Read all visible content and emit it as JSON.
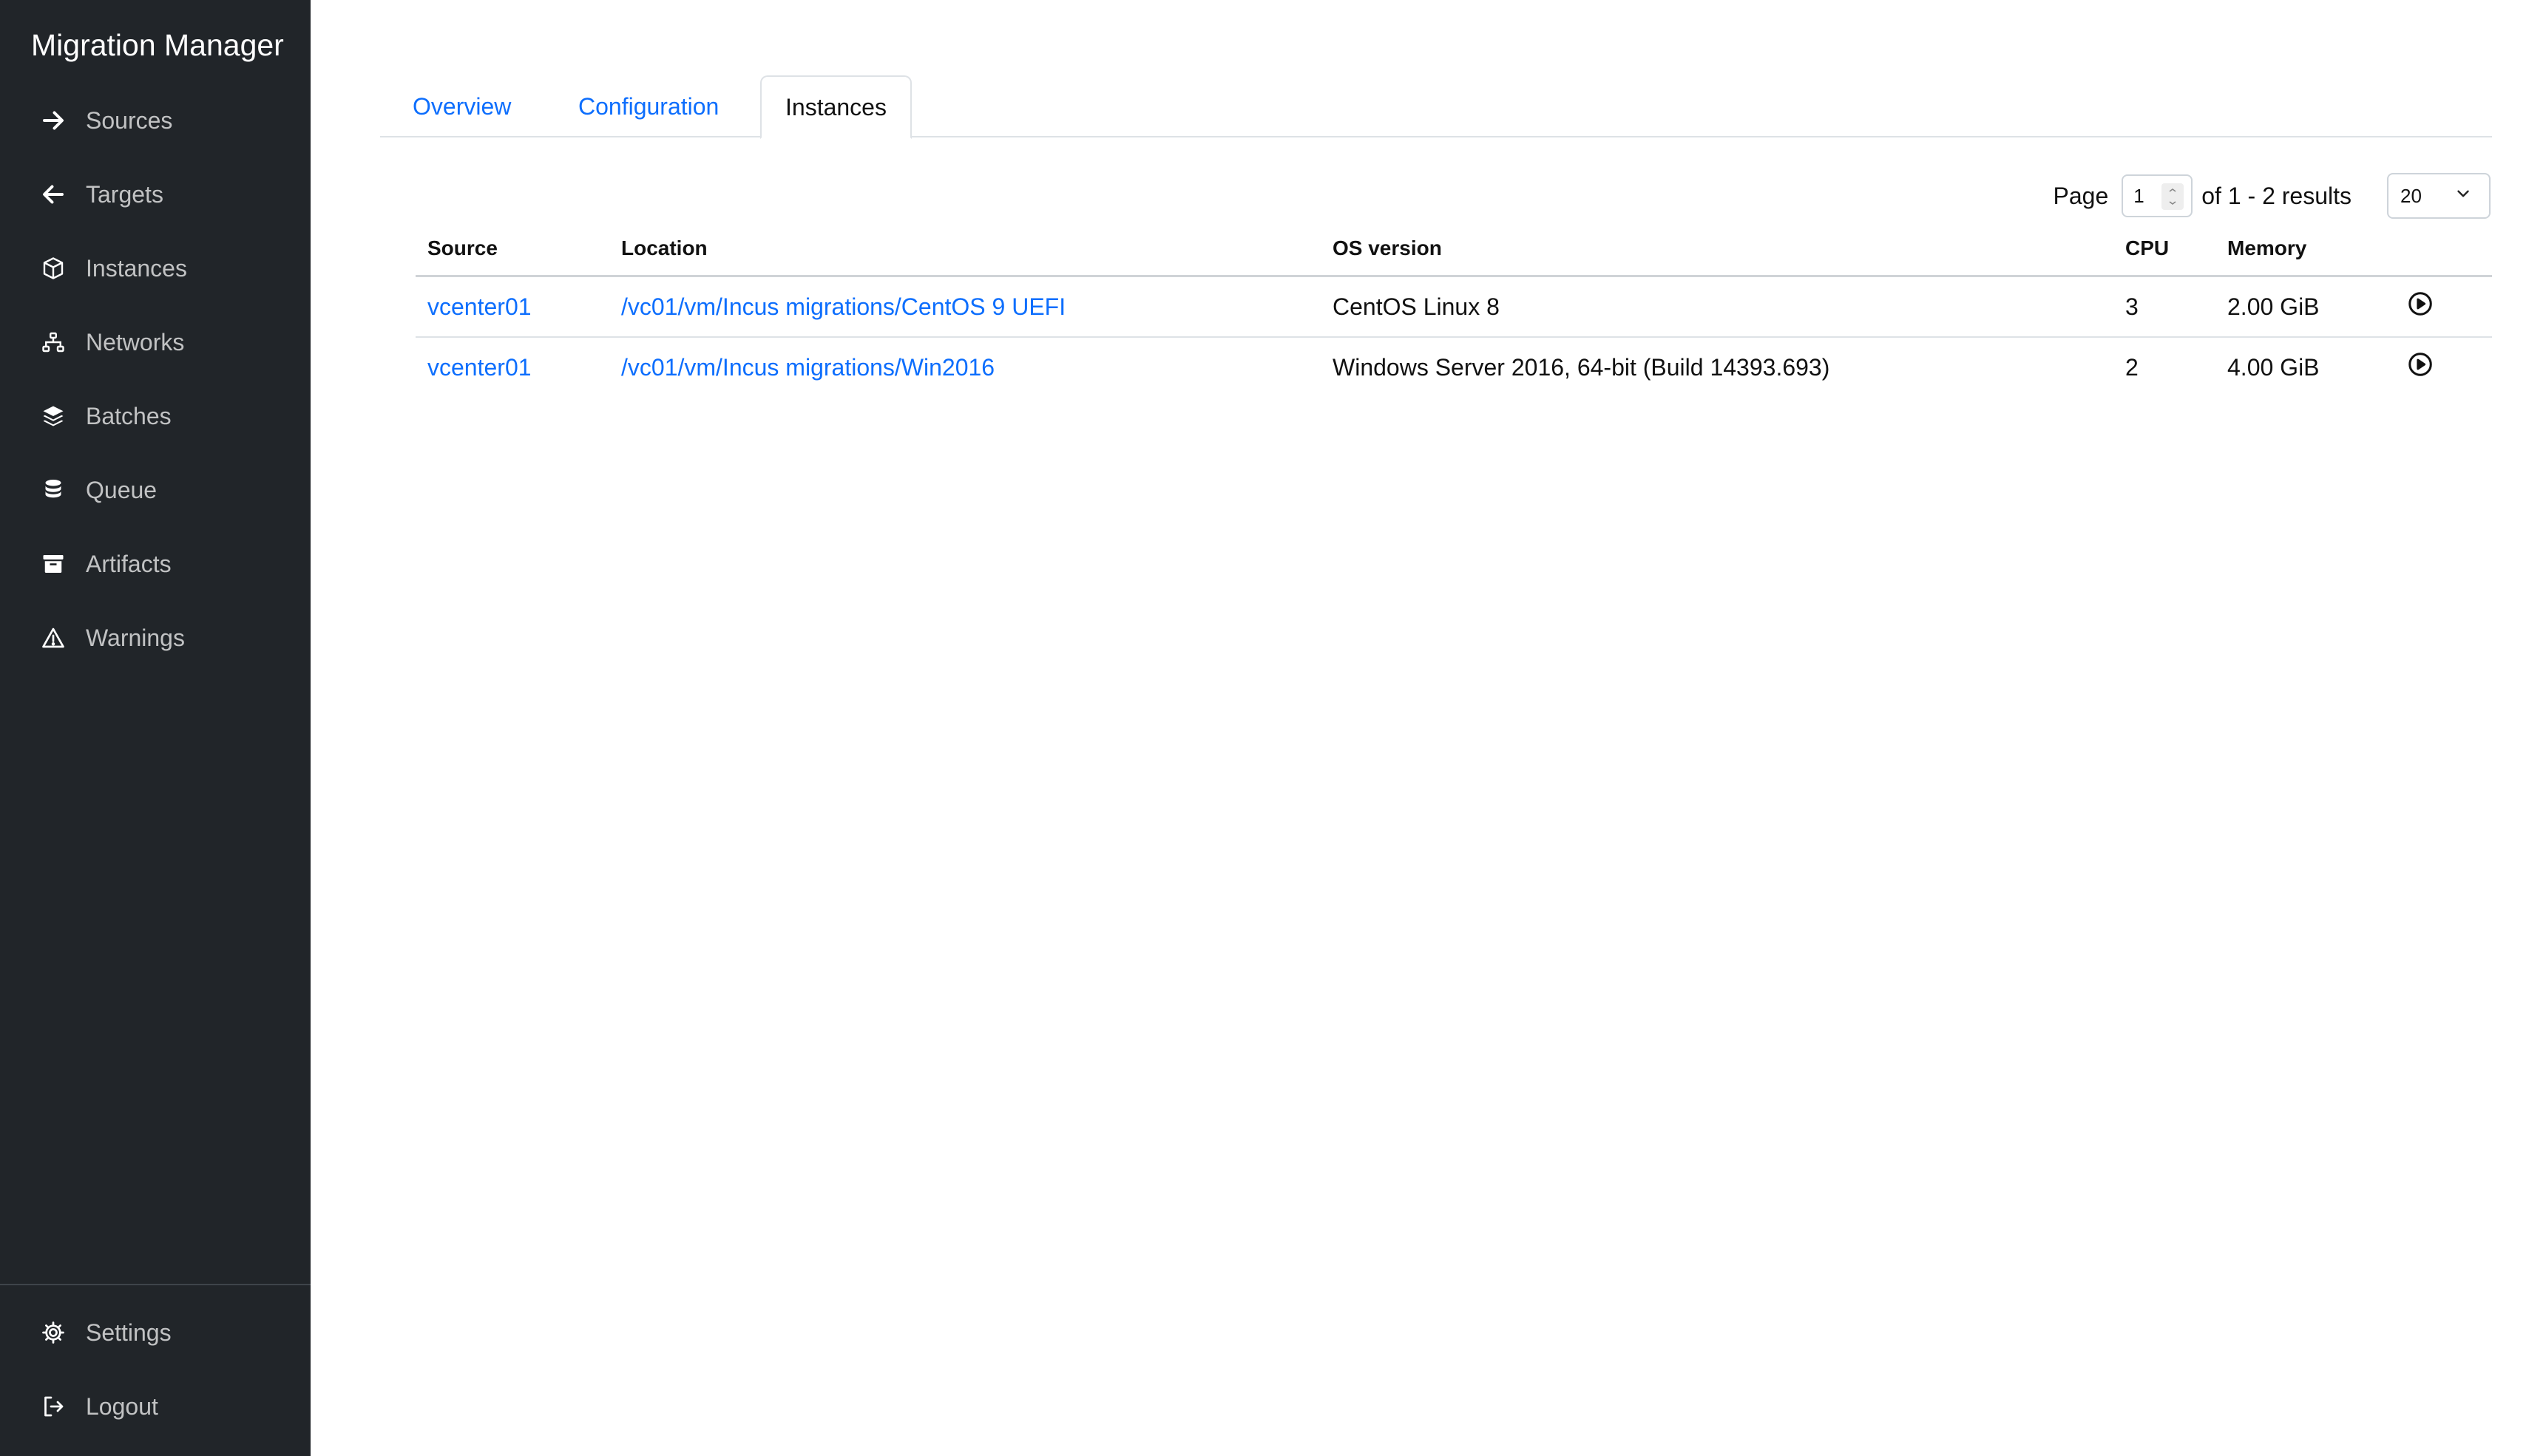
{
  "app": {
    "title": "Migration Manager"
  },
  "sidebar": {
    "items": [
      {
        "label": "Sources",
        "icon": "arrow-right-icon"
      },
      {
        "label": "Targets",
        "icon": "arrow-left-icon"
      },
      {
        "label": "Instances",
        "icon": "box-icon"
      },
      {
        "label": "Networks",
        "icon": "network-icon"
      },
      {
        "label": "Batches",
        "icon": "layers-icon"
      },
      {
        "label": "Queue",
        "icon": "database-icon"
      },
      {
        "label": "Artifacts",
        "icon": "archive-icon"
      },
      {
        "label": "Warnings",
        "icon": "warning-icon"
      }
    ],
    "bottom_items": [
      {
        "label": "Settings",
        "icon": "gear-icon"
      },
      {
        "label": "Logout",
        "icon": "logout-icon"
      }
    ]
  },
  "tabs": [
    {
      "label": "Overview",
      "active": false
    },
    {
      "label": "Configuration",
      "active": false
    },
    {
      "label": "Instances",
      "active": true
    }
  ],
  "pagination": {
    "page_label": "Page",
    "page_value": "1",
    "of_label": "of 1 - 2 results",
    "per_page": "20"
  },
  "table": {
    "columns": [
      "Source",
      "Location",
      "OS version",
      "CPU",
      "Memory"
    ],
    "rows": [
      {
        "source": "vcenter01",
        "location": "/vc01/vm/Incus migrations/CentOS 9 UEFI",
        "os": "CentOS Linux 8",
        "cpu": "3",
        "memory": "2.00 GiB"
      },
      {
        "source": "vcenter01",
        "location": "/vc01/vm/Incus migrations/Win2016",
        "os": "Windows Server 2016, 64-bit (Build 14393.693)",
        "cpu": "2",
        "memory": "4.00 GiB"
      }
    ]
  }
}
